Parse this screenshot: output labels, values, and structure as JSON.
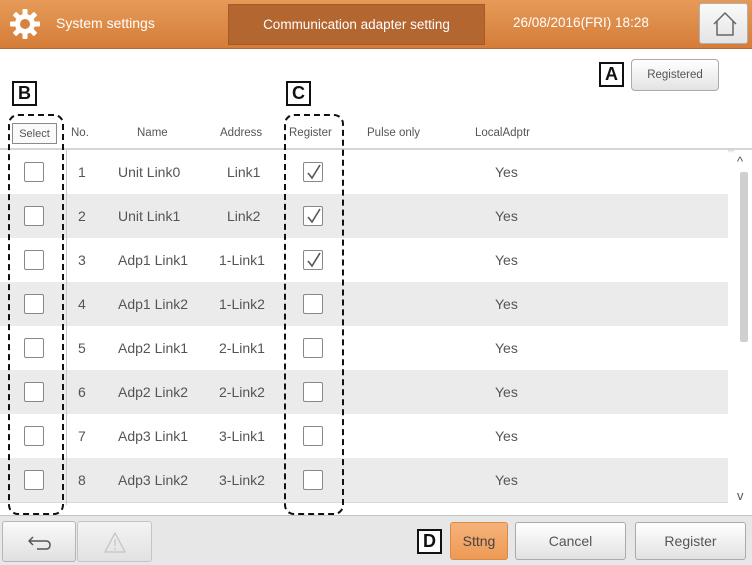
{
  "header": {
    "app_title": "System settings",
    "screen_title": "Communication adapter setting",
    "datetime": "26/08/2016(FRI) 18:28",
    "home_icon": "home-icon",
    "gear_icon": "gear-icon"
  },
  "toolbar": {
    "registered_label": "Registered"
  },
  "callouts": {
    "a": "A",
    "b": "B",
    "c": "C",
    "d": "D"
  },
  "columns": {
    "select": "Select",
    "no": "No.",
    "name": "Name",
    "address": "Address",
    "register": "Register",
    "pulse_only": "Pulse only",
    "local_adptr": "LocalAdptr"
  },
  "rows": [
    {
      "no": "1",
      "name": "Unit Link0",
      "address": "Link1",
      "selected": false,
      "register": true,
      "pulse_only": "",
      "local": "Yes"
    },
    {
      "no": "2",
      "name": "Unit Link1",
      "address": "Link2",
      "selected": false,
      "register": true,
      "pulse_only": "",
      "local": "Yes"
    },
    {
      "no": "3",
      "name": "Adp1 Link1",
      "address": "1-Link1",
      "selected": false,
      "register": true,
      "pulse_only": "",
      "local": "Yes"
    },
    {
      "no": "4",
      "name": "Adp1 Link2",
      "address": "1-Link2",
      "selected": false,
      "register": false,
      "pulse_only": "",
      "local": "Yes"
    },
    {
      "no": "5",
      "name": "Adp2 Link1",
      "address": "2-Link1",
      "selected": false,
      "register": false,
      "pulse_only": "",
      "local": "Yes"
    },
    {
      "no": "6",
      "name": "Adp2 Link2",
      "address": "2-Link2",
      "selected": false,
      "register": false,
      "pulse_only": "",
      "local": "Yes"
    },
    {
      "no": "7",
      "name": "Adp3 Link1",
      "address": "3-Link1",
      "selected": false,
      "register": false,
      "pulse_only": "",
      "local": "Yes"
    },
    {
      "no": "8",
      "name": "Adp3 Link2",
      "address": "3-Link2",
      "selected": false,
      "register": false,
      "pulse_only": "",
      "local": "Yes"
    }
  ],
  "scrollbar": {
    "up": "^",
    "down": "v"
  },
  "footer": {
    "back_icon": "back-arrow-icon",
    "warning_icon": "warning-icon",
    "sttng_label": "Sttng",
    "cancel_label": "Cancel",
    "register_label": "Register"
  },
  "colors": {
    "header_orange": "#d8823d",
    "title_box": "#b46630",
    "sttng_orange": "#f2a463",
    "row_alt": "#ebebeb"
  }
}
